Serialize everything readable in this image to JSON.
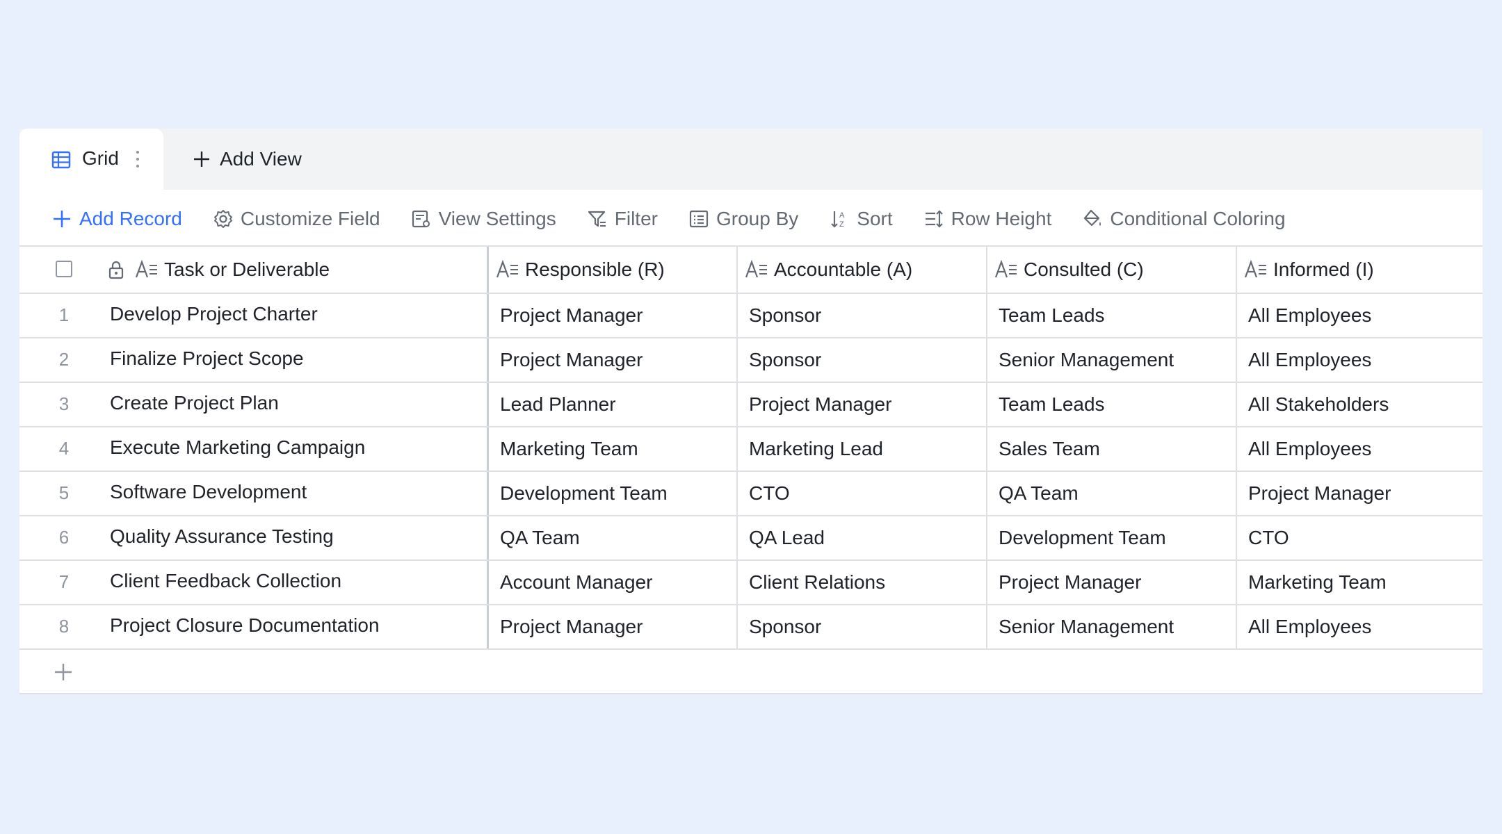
{
  "tabs": {
    "active_label": "Grid",
    "add_view_label": "Add View"
  },
  "toolbar": {
    "add_record": "Add Record",
    "customize_field": "Customize Field",
    "view_settings": "View Settings",
    "filter": "Filter",
    "group_by": "Group By",
    "sort": "Sort",
    "row_height": "Row Height",
    "conditional_coloring": "Conditional Coloring"
  },
  "colors": {
    "accent": "#3370ff",
    "background": "#e8effd",
    "toolbar_text": "#646a73"
  },
  "table": {
    "columns": [
      "Task or Deliverable",
      "Responsible (R)",
      "Accountable (A)",
      "Consulted (C)",
      "Informed (I)"
    ],
    "rows": [
      {
        "num": "1",
        "task": "Develop Project Charter",
        "r": "Project Manager",
        "a": "Sponsor",
        "c": "Team Leads",
        "i": "All Employees"
      },
      {
        "num": "2",
        "task": "Finalize Project Scope",
        "r": "Project Manager",
        "a": "Sponsor",
        "c": "Senior Management",
        "i": "All Employees"
      },
      {
        "num": "3",
        "task": "Create Project Plan",
        "r": "Lead Planner",
        "a": "Project Manager",
        "c": "Team Leads",
        "i": "All Stakeholders"
      },
      {
        "num": "4",
        "task": "Execute Marketing Campaign",
        "r": "Marketing Team",
        "a": "Marketing Lead",
        "c": "Sales Team",
        "i": "All Employees"
      },
      {
        "num": "5",
        "task": "Software Development",
        "r": "Development Team",
        "a": "CTO",
        "c": "QA Team",
        "i": "Project Manager"
      },
      {
        "num": "6",
        "task": "Quality Assurance Testing",
        "r": "QA Team",
        "a": "QA Lead",
        "c": "Development Team",
        "i": "CTO"
      },
      {
        "num": "7",
        "task": "Client Feedback Collection",
        "r": "Account Manager",
        "a": "Client Relations",
        "c": "Project Manager",
        "i": "Marketing Team"
      },
      {
        "num": "8",
        "task": "Project Closure Documentation",
        "r": "Project Manager",
        "a": "Sponsor",
        "c": "Senior Management",
        "i": "All Employees"
      }
    ]
  }
}
